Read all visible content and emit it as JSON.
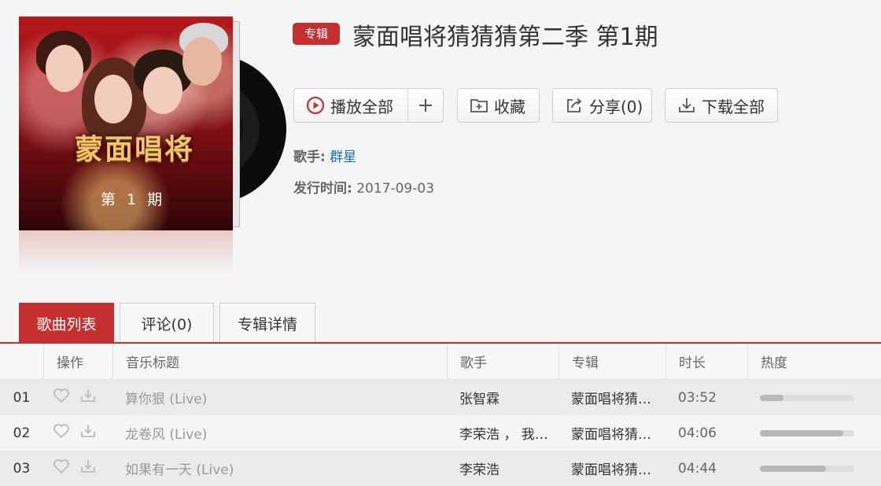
{
  "album": {
    "badge": "专辑",
    "title": "蒙面唱将猜猜猜第二季 第1期",
    "cover_logo": "蒙面唱将",
    "cover_episode": "第 1 期",
    "singer_label": "歌手:",
    "singer": "群星",
    "date_label": "发行时间:",
    "date": "2017-09-03"
  },
  "actions": {
    "play_all": "播放全部",
    "add_icon": "plus-icon",
    "collect": "收藏",
    "share": "分享(0)",
    "download_all": "下载全部"
  },
  "tabs": [
    {
      "label": "歌曲列表",
      "active": true
    },
    {
      "label": "评论(0)",
      "active": false
    },
    {
      "label": "专辑详情",
      "active": false
    }
  ],
  "table": {
    "headers": {
      "index": "",
      "op": "操作",
      "title": "音乐标题",
      "singer": "歌手",
      "album": "专辑",
      "duration": "时长",
      "heat": "热度"
    },
    "rows": [
      {
        "index": "01",
        "title": "算你狠 (Live)",
        "singer": "张智霖",
        "album": "蒙面唱将猜…",
        "duration": "03:52",
        "heat": 0.25
      },
      {
        "index": "02",
        "title": "龙卷风 (Live)",
        "singer": "李荣浩 ， 我…",
        "album": "蒙面唱将猜…",
        "duration": "04:06",
        "heat": 0.88
      },
      {
        "index": "03",
        "title": "如果有一天 (Live)",
        "singer": "李荣浩",
        "album": "蒙面唱将猜…",
        "duration": "04:44",
        "heat": 0.7
      }
    ]
  },
  "colors": {
    "accent": "#c62f2f",
    "link": "#0c73c2"
  }
}
